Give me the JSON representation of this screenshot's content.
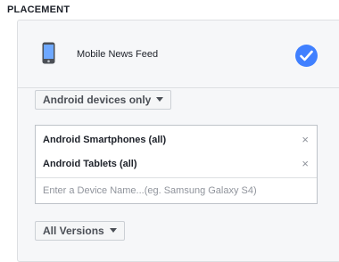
{
  "section": {
    "title": "PLACEMENT"
  },
  "placement": {
    "label": "Mobile News Feed",
    "selected": true,
    "icon": "mobile-phone-icon"
  },
  "device_filter": {
    "label": "Android devices only"
  },
  "devices": {
    "items": [
      {
        "label": "Android Smartphones (all)",
        "remove": "×"
      },
      {
        "label": "Android Tablets (all)",
        "remove": "×"
      }
    ],
    "input_placeholder": "Enter a Device Name...(eg. Samsung Galaxy S4)",
    "input_value": ""
  },
  "versions": {
    "label": "All Versions"
  },
  "colors": {
    "accent": "#4080ff",
    "panel_bg": "#f6f7f9",
    "border": "#dddfe2"
  }
}
